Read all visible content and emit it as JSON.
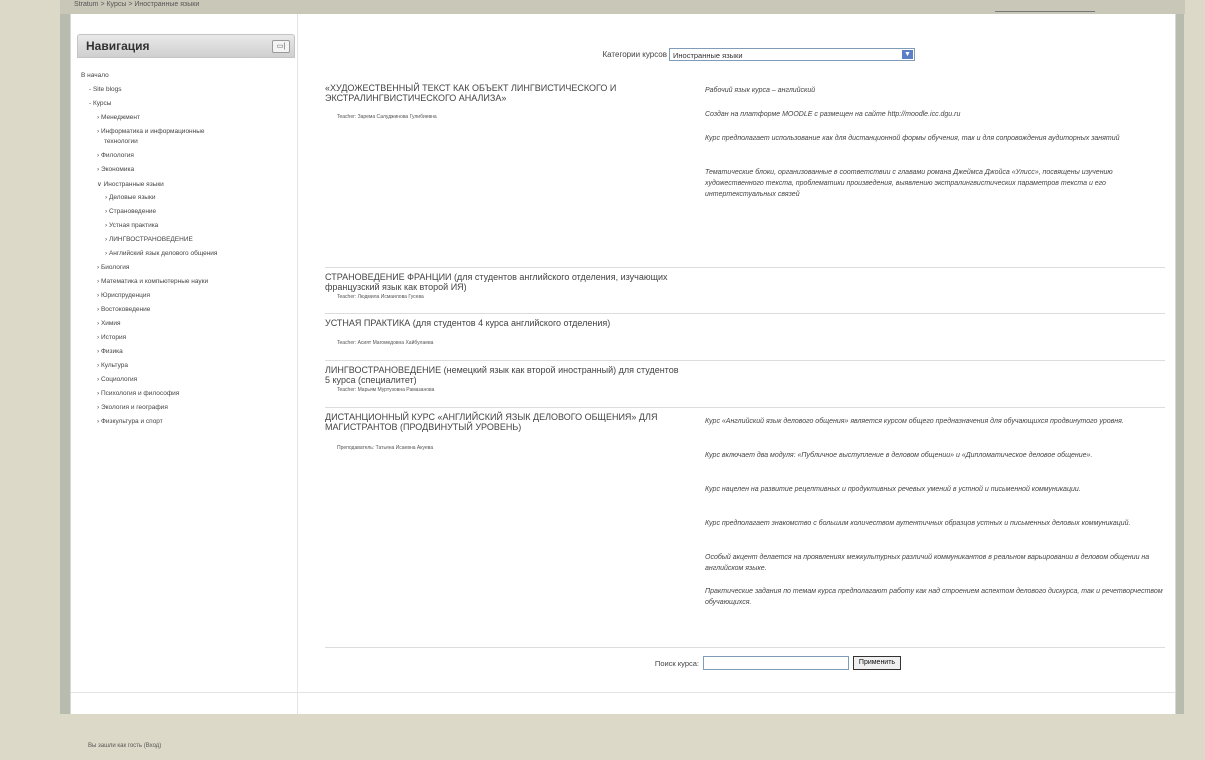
{
  "topbar": {
    "breadcrumb": "Stratum > Курсы > Иностранные языки"
  },
  "nav": {
    "title": "Навигация",
    "ctrl_icon": "block-control-icon",
    "items": [
      {
        "label": "В начало"
      },
      {
        "label": "- Site blogs"
      },
      {
        "label": "- Курсы"
      },
      {
        "label": "› Менеджмент"
      },
      {
        "label": "› Информатика и информационные"
      },
      {
        "label": "технологии"
      },
      {
        "label": "› Филология"
      },
      {
        "label": "› Экономика"
      },
      {
        "label": "∨ Иностранные языки"
      },
      {
        "label": "› Деловые языки"
      },
      {
        "label": "› Страноведение"
      },
      {
        "label": "› Устная практика"
      },
      {
        "label": "› ЛИНГВОСТРАНОВЕДЕНИЕ"
      },
      {
        "label": "› Английский язык делового общения"
      },
      {
        "label": "› Биология"
      },
      {
        "label": "› Математика и компьютерные науки"
      },
      {
        "label": "› Юриспруденция"
      },
      {
        "label": "› Востоковедение"
      },
      {
        "label": "› Химия"
      },
      {
        "label": "› История"
      },
      {
        "label": "› Физика"
      },
      {
        "label": "› Культура"
      },
      {
        "label": "› Социология"
      },
      {
        "label": "› Психология и философия"
      },
      {
        "label": "› Экология и география"
      },
      {
        "label": "› Физкультура и спорт"
      }
    ]
  },
  "category": {
    "label": "Категории курсов",
    "selected": "Иностранные языки"
  },
  "courses": [
    {
      "title": "«ХУДОЖЕСТВЕННЫЙ ТЕКСТ КАК ОБЪЕКТ ЛИНГВИСТИЧЕСКОГО И ЭКСТРАЛИНГВИСТИЧЕСКОГО АНАЛИЗА»",
      "teacher": "Teacher: Зарема Салуджинова Гулибиевна",
      "summary": [
        "Рабочий язык курса – английский",
        "Создан на платформе MOODLE с размещен на сайте http://moodle.icc.dgu.ru",
        "Курс предполагает использование как для дистанционной формы обучения, так и для сопровождения аудиторных занятий",
        "Тематические блоки, организованные в соответствии с главами романа Джеймса Джойса «Улисс», посвящены изучению художественного текста, проблематики произведения, выявлению экстралингвистических параметров текста и его интертекстуальных связей"
      ]
    },
    {
      "title": "СТРАНОВЕДЕНИЕ ФРАНЦИИ (для студентов английского отделения, изучающих французский язык как второй ИЯ)",
      "teacher": "Teacher: Людмила Исмаилова Гусева",
      "summary": []
    },
    {
      "title": "УСТНАЯ ПРАКТИКА (для студентов 4 курса английского отделения)",
      "teacher": "Teacher: Асият Магомедовна Хайбулаева",
      "summary": []
    },
    {
      "title": "ЛИНГВОСТРАНОВЕДЕНИЕ (немецкий язык как второй иностранный) для студентов 5 курса (специалитет)",
      "teacher": "Teacher: Марьям Муртузовна Рамазанова",
      "summary": []
    },
    {
      "title": "ДИСТАНЦИОННЫЙ КУРС «АНГЛИЙСКИЙ ЯЗЫК ДЕЛОВОГО ОБЩЕНИЯ» ДЛЯ МАГИСТРАНТОВ (ПРОДВИНУТЫЙ УРОВЕНЬ)",
      "teacher": "Преподаватель: Татьяна Исаевна Акуева",
      "summary": [
        "Курс «Английский язык делового общения» является курсом общего предназначения для обучающихся продвинутого уровня.",
        "Курс включает два модуля: «Публичное выступление в деловом общении» и «Дипломатическое деловое общение».",
        "Курс нацелен на развитие рецептивных и продуктивных речевых умений в устной и письменной коммуникации.",
        "Курс предполагает знакомство с большим количеством аутентичных образцов устных и письменных деловых коммуникаций.",
        "Особый акцент делается на проявлениях межкультурных различий коммуникантов в реальном варьировании в деловом общении на английском языке.",
        "Практические задания по темам курса предполагают работу как над строением аспектом делового дискурса, так и речетворчеством обучающихся."
      ]
    }
  ],
  "search": {
    "label": "Поиск курса:",
    "value": "",
    "button": "Применить"
  },
  "footer": {
    "note": "Вы зашли как гость (Вход)"
  }
}
